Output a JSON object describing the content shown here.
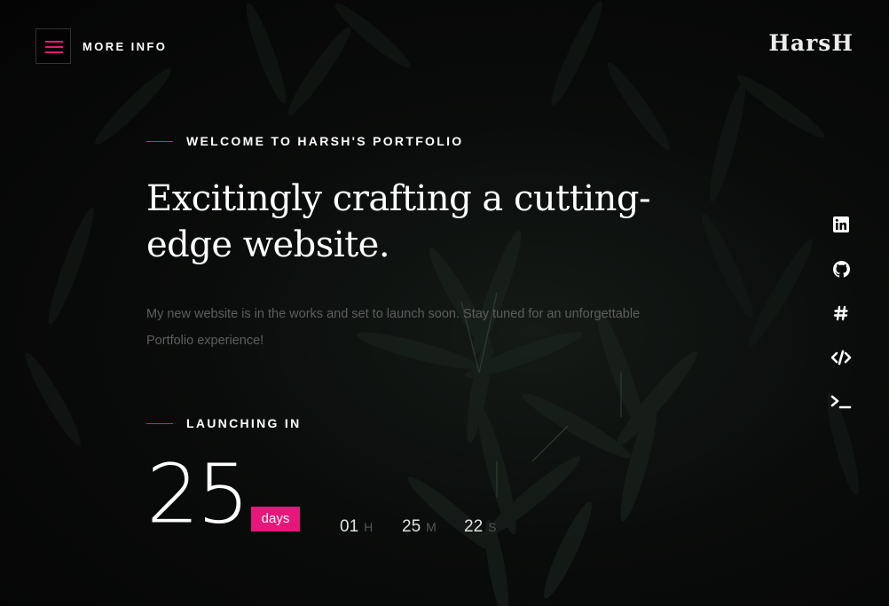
{
  "header": {
    "menu_label": "MORE INFO",
    "logo": "HarsH"
  },
  "hero": {
    "eyebrow": "WELCOME TO HARSH'S PORTFOLIO",
    "headline": "Excitingly crafting a cutting-edge website.",
    "description": "My new website is in the works and set to launch soon. Stay tuned for an unforgettable Portfolio experience!"
  },
  "countdown": {
    "label": "LAUNCHING IN",
    "days": "25",
    "days_label": "days",
    "hours": "01",
    "hours_unit": "H",
    "minutes": "25",
    "minutes_unit": "M",
    "seconds": "22",
    "seconds_unit": "S"
  },
  "social": [
    "linkedin-icon",
    "github-icon",
    "hashtag-icon",
    "code-icon",
    "terminal-icon"
  ],
  "colors": {
    "accent": "#e6177a",
    "background": "#050505",
    "text": "#ffffff",
    "muted": "#5e5e5e"
  }
}
